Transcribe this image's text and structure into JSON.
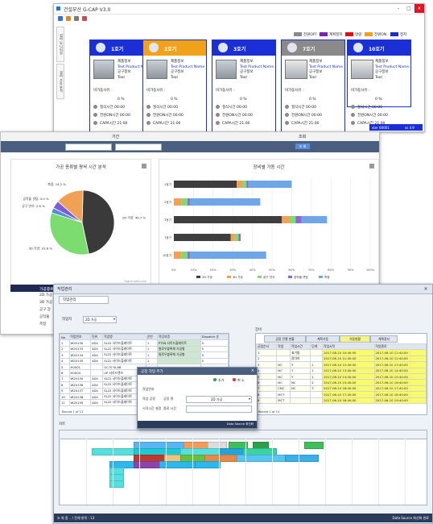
{
  "window1": {
    "title": "건설부산 G-CAP V3.0",
    "legend": [
      {
        "label": "전원OFF",
        "color": "#8a8a8a"
      },
      {
        "label": "계획정지",
        "color": "#7d1fb8"
      },
      {
        "label": "알람",
        "color": "#e01010"
      },
      {
        "label": "전원ON",
        "color": "#f2a21a"
      },
      {
        "label": "정지",
        "color": "#1a2fd6"
      }
    ],
    "side_tabs": [
      "설비 모니터링",
      "설비 가동 분석"
    ],
    "card_labels": {
      "product": "제품정보",
      "product_name": "Test Product Name",
      "tool_info": "공구정보",
      "tool": "Tool",
      "rate": "비가동사유 :",
      "pct": "0 %",
      "row1": "절삭시간",
      "row1_val": "00:00",
      "row2": "전원ON시간",
      "row2_val": "00:00",
      "row3": "CAPA시간",
      "row3_val": "21:00"
    },
    "cards": [
      {
        "name": "1호기",
        "color": "#1a2fd6"
      },
      {
        "name": "2호기",
        "color": "#f2a21a"
      },
      {
        "name": "3호기",
        "color": "#1a2fd6"
      },
      {
        "name": "7호기",
        "color": "#8a8a8a"
      },
      {
        "name": "10호기",
        "color": "#1a2fd6"
      }
    ],
    "status_bar": [
      "ster 00001",
      "ss 4.9"
    ]
  },
  "window2": {
    "header": "기간",
    "header_right": "조회",
    "search_btn": "조 회",
    "pie_title": "가공 종류별 평셕 시간 분석",
    "bar_title": "장비별 가동 시간",
    "watermark": "Highcharts.com",
    "table1_headers": [
      "가공종류",
      "시간(hour)"
    ],
    "table1_rows": [
      "2D 가공",
      "3D 가공",
      "공구 장",
      "공작물",
      "측정"
    ],
    "table2_headers": [
      "장비명",
      "2D 가공",
      "3D 가공",
      "공구 연삭",
      "공작물 셋팅",
      "측정"
    ]
  },
  "chart_data": [
    {
      "type": "pie",
      "title": "가공 종류별 평셕 시간 분석",
      "labels": [
        "2D 가공",
        "3D 가공",
        "공구 연삭",
        "공작물 셋팅",
        "측정"
      ],
      "display_labels": [
        "2D 가공: 46.7 %",
        "3D 가공: 33.6 %",
        "공구 연삭: 2.6 %",
        "공작물 셋팅: 4.0 %",
        "측정: 14.2 %"
      ],
      "values": [
        46.7,
        33.6,
        2.6,
        4.0,
        14.2
      ],
      "colors": [
        "#3a3a3a",
        "#7ddc6f",
        "#4f8ce0",
        "#7d5dd6",
        "#f0a156"
      ]
    },
    {
      "type": "bar",
      "stacked": true,
      "orientation": "horizontal",
      "title": "장비별 가동 시간",
      "categories": [
        "1호기",
        "2호기",
        "3호기",
        "7호기",
        "10호기"
      ],
      "xlim": [
        0,
        100
      ],
      "xticks": [
        "0%",
        "10%",
        "20%",
        "30%",
        "40%",
        "50%",
        "60%",
        "70%",
        "80%",
        "90%",
        "100%"
      ],
      "series": [
        {
          "name": "2D 가공",
          "color": "#3e3e3e",
          "values": [
            32,
            0,
            55,
            29,
            0
          ]
        },
        {
          "name": "3D 가공",
          "color": "#f0a156",
          "values": [
            3,
            4,
            4,
            2,
            4
          ]
        },
        {
          "name": "공구 연삭",
          "color": "#7ddc6f",
          "values": [
            2,
            3,
            3,
            2,
            3
          ]
        },
        {
          "name": "공작물 셋팅",
          "color": "#8a68d8",
          "values": [
            1,
            1,
            3,
            1,
            1
          ]
        },
        {
          "name": "측정",
          "color": "#6fa6e8",
          "values": [
            22,
            36,
            13,
            0,
            39
          ]
        }
      ]
    }
  ],
  "window3": {
    "title": "작업관리",
    "tabs": [
      "작업관리",
      "작업관리"
    ],
    "filter_label": "작업지",
    "filter_value": "2D 가공",
    "left_headers": [
      "No",
      "작업번호",
      "단위",
      "작업명",
      "순번",
      "작업지명",
      "Dispatch 순"
    ],
    "left_rows": [
      [
        "1",
        "W20130",
        "4D4",
        "SL22 사이드플레이트",
        "1",
        "PTS6 사이드플레이트",
        "5"
      ],
      [
        "2",
        "W20133",
        "4D4",
        "SL22 사이드플레이트",
        "1",
        "필로우블록체 가공형",
        "5"
      ],
      [
        "3",
        "W20134",
        "4D4",
        "SL22 사이드플레이트",
        "1",
        "필로우블록체 가공형",
        "5"
      ],
      [
        "4",
        "W20135",
        "4D4",
        "SL22 사이드플레이트",
        "1",
        "",
        "5"
      ],
      [
        "5",
        "H0001",
        "",
        "UC70 SLAB",
        "",
        "",
        ""
      ],
      [
        "6",
        "H0004",
        "",
        "UP 사이드렌즈",
        "",
        "",
        ""
      ],
      [
        "7",
        "W20130",
        "4D4",
        "SL22 사이드플레이트",
        "",
        "",
        ""
      ],
      [
        "8",
        "W20136",
        "4D4",
        "SL22 사이드플레이트",
        "",
        "",
        ""
      ],
      [
        "9",
        "W20137",
        "4D4",
        "SL22 사이드플레이트",
        "",
        "",
        ""
      ],
      [
        "10",
        "W20138",
        "4D4",
        "SL22 사이드플레이트",
        "",
        "",
        ""
      ],
      [
        "11",
        "W20139",
        "4D4",
        "SL22 사이드플레이트",
        "",
        "",
        ""
      ]
    ],
    "right_label": "장비",
    "right_tabs": [
      "공정 진행 현황",
      "계획가동",
      "가동현황",
      "계획정지"
    ],
    "right_headers": [
      "공정순서",
      "작업",
      "작업시간",
      "단계",
      "작업시작",
      "작업종료"
    ],
    "right_rows": [
      [
        "1",
        "",
        "표기말",
        "",
        "2017-06-10 10:40:00",
        "2017-06-10 11:40:00"
      ],
      [
        "2",
        "",
        "갈아끼",
        "",
        "2017-06-10 11:40:00",
        "2017-06-10 12:40:00"
      ],
      [
        "3",
        "NC",
        "Y",
        "1",
        "2017-06-10 12:40:00",
        "2017-06-10 13:40:00"
      ],
      [
        "4",
        "NC",
        "Y",
        "1",
        "2017-06-10 13:40:00",
        "2017-06-10 14:40:00"
      ],
      [
        "5",
        "NC",
        "Y",
        "1",
        "2017-06-10 14:40:00",
        "2017-06-10 15:40:00"
      ],
      [
        "6",
        "NC",
        "NC",
        "2",
        "2017-06-10 15:40:00",
        "2017-06-10 16:40:00"
      ],
      [
        "7",
        "CNC",
        "NC",
        "3",
        "2017-06-10 16:40:00",
        "2017-06-10 17:40:00"
      ],
      [
        "8",
        "MCT",
        "",
        "",
        "2017-06-10 17:40:00",
        "2017-06-10 18:40:00"
      ],
      [
        "9",
        "MCT",
        "",
        "",
        "2017-06-10 18:40:00",
        "2017-06-10 19:40:00"
      ]
    ],
    "bottom_label": "차트",
    "status": "조 회 중 .. / 전체 항목 : 13",
    "status_right": "Data Source 최신화 완료",
    "pager": "Record 1 of 13"
  },
  "popup": {
    "title": "공정 작업 추가",
    "add_btn": "추가",
    "close_btn": "취 소",
    "label1": "작업번호",
    "label2": "작업 공정",
    "label2b": "공정 명",
    "value2": "2D 가공",
    "label3": "시작시간 설정",
    "label3b": "종료 시간",
    "footer": "Data Source 최신화"
  }
}
